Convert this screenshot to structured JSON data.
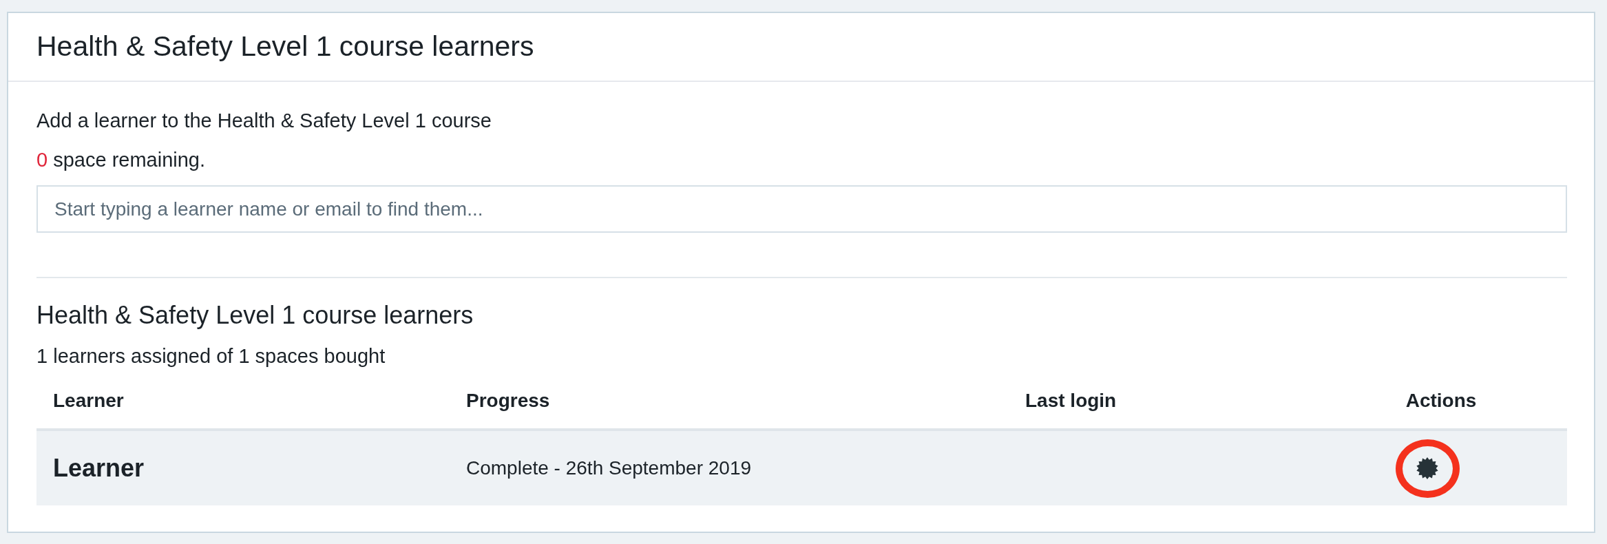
{
  "page_title": "Health & Safety Level 1 course learners",
  "add_learner": {
    "heading": "Add a learner to the Health & Safety Level 1 course",
    "remaining_count": "0",
    "remaining_text": "space remaining.",
    "search": {
      "placeholder": "Start typing a learner name or email to find them..."
    }
  },
  "learners_section": {
    "title": "Health & Safety Level 1 course learners",
    "summary": "1 learners assigned of 1 spaces bought"
  },
  "table": {
    "columns": [
      "Learner",
      "Progress",
      "Last login",
      "Actions"
    ],
    "rows": [
      {
        "learner": "Learner",
        "progress": "Complete - 26th September 2019",
        "highlighted": true
      }
    ]
  }
}
